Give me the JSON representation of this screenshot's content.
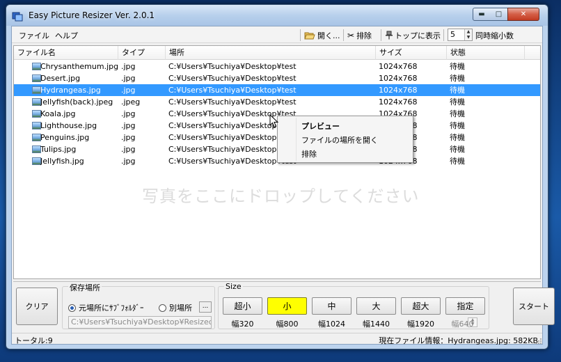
{
  "window": {
    "title": "Easy Picture Resizer Ver. 2.0.1"
  },
  "menu": {
    "file": "ファイル",
    "help": "ヘルプ"
  },
  "toolbar": {
    "open": "開く...",
    "remove": "排除",
    "top": "トップに表示",
    "concurrent_value": "5",
    "concurrent_label": "同時縮小数"
  },
  "list": {
    "columns": [
      "ファイル名",
      "タイプ",
      "場所",
      "サイズ",
      "状態"
    ],
    "rows": [
      {
        "name": "Chrysanthemum.jpg",
        "type": ".jpg",
        "location": "C:¥Users¥Tsuchiya¥Desktop¥test",
        "size": "1024x768",
        "status": "待機"
      },
      {
        "name": "Desert.jpg",
        "type": ".jpg",
        "location": "C:¥Users¥Tsuchiya¥Desktop¥test",
        "size": "1024x768",
        "status": "待機"
      },
      {
        "name": "Hydrangeas.jpg",
        "type": ".jpg",
        "location": "C:¥Users¥Tsuchiya¥Desktop¥test",
        "size": "1024x768",
        "status": "待機"
      },
      {
        "name": "Jellyfish(back).jpeg",
        "type": ".jpeg",
        "location": "C:¥Users¥Tsuchiya¥Desktop¥test",
        "size": "1024x768",
        "status": "待機"
      },
      {
        "name": "Koala.jpg",
        "type": ".jpg",
        "location": "C:¥Users¥Tsuchiya¥Desktop¥test",
        "size": "1024x768",
        "status": "待機"
      },
      {
        "name": "Lighthouse.jpg",
        "type": ".jpg",
        "location": "C:¥Users¥Tsuchiya¥Desktop¥test",
        "size": "1024x768",
        "status": "待機"
      },
      {
        "name": "Penguins.jpg",
        "type": ".jpg",
        "location": "C:¥Users¥Tsuchiya¥Desktop¥test",
        "size": "1024x768",
        "status": "待機"
      },
      {
        "name": "Tulips.jpg",
        "type": ".jpg",
        "location": "C:¥Users¥Tsuchiya¥Desktop¥test",
        "size": "1024x768",
        "status": "待機"
      },
      {
        "name": "Jellyfish.jpg",
        "type": ".jpg",
        "location": "C:¥Users¥Tsuchiya¥Desktop¥test",
        "size": "1024x768",
        "status": "待機"
      }
    ],
    "selected_index": 2,
    "drop_hint": "写真をここにドロップしてください"
  },
  "context_menu": {
    "preview": "プレビュー",
    "open_location": "ファイルの場所を開く",
    "remove": "排除"
  },
  "save": {
    "group_title": "保存場所",
    "option_subfolder": "元場所にｻﾌﾞﾌｫﾙﾀﾞｰ",
    "option_other": "別場所",
    "browse": "...",
    "path": "C:¥Users¥Tsuchiya¥Desktop¥ResizedPi"
  },
  "size": {
    "group_title": "Size",
    "buttons": [
      {
        "label": "超小",
        "caption": "幅320"
      },
      {
        "label": "小",
        "caption": "幅800"
      },
      {
        "label": "中",
        "caption": "幅1024"
      },
      {
        "label": "大",
        "caption": "幅1440"
      },
      {
        "label": "超大",
        "caption": "幅1920"
      },
      {
        "label": "指定",
        "caption": "幅640"
      }
    ],
    "active_index": 1,
    "active_color": "#ffff00"
  },
  "buttons": {
    "clear": "クリア",
    "start": "スタート"
  },
  "status": {
    "total": "トータル:9",
    "info": "現在ファイル情報：Hydrangeas.jpg: 582KB"
  },
  "icons": [
    "app-icon",
    "folder-open-icon",
    "scissors-icon",
    "pin-icon",
    "image-file-icon",
    "mouse-cursor-icon",
    "minimize-icon",
    "maximize-icon",
    "close-icon"
  ]
}
